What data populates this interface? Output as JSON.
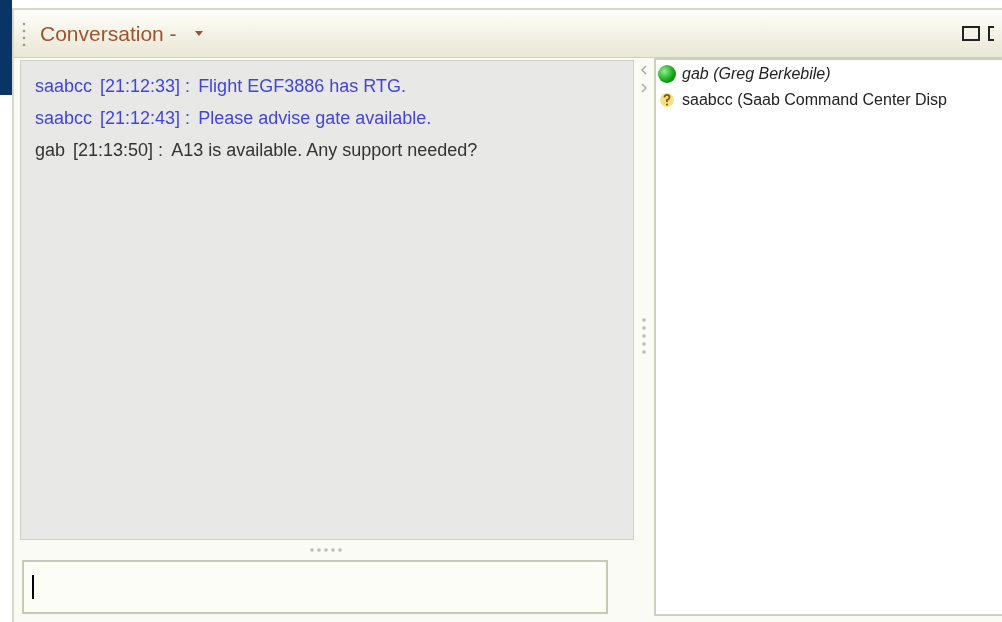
{
  "view": {
    "title": "Conversation -"
  },
  "messages": [
    {
      "sender": "saabcc",
      "time": "[21:12:33] :",
      "text": "Flight EGF3886 has RTG.",
      "color": "#4444dd"
    },
    {
      "sender": "saabcc",
      "time": "[21:12:43] :",
      "text": "Please advise gate available.",
      "color": "#4444dd"
    },
    {
      "sender": "gab",
      "time": "[21:13:50] :",
      "text": "A13 is available. Any support needed?",
      "color": "#333333"
    }
  ],
  "participants": [
    {
      "name": "gab (Greg Berkebile)",
      "kind": "online"
    },
    {
      "name": "saabcc (Saab Command Center Disp",
      "kind": "unknown"
    }
  ]
}
